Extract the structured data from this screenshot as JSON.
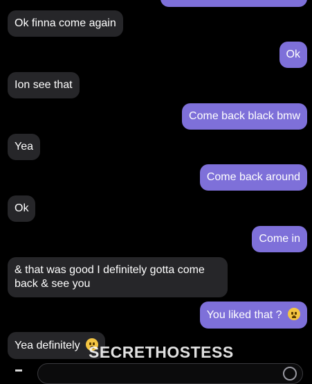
{
  "messages": [
    {
      "direction": "out",
      "text": ""
    },
    {
      "direction": "in",
      "text": "Ok finna come again"
    },
    {
      "direction": "out",
      "text": "Ok"
    },
    {
      "direction": "in",
      "text": "Ion see that"
    },
    {
      "direction": "out",
      "text": "Come back black bmw"
    },
    {
      "direction": "in",
      "text": "Yea"
    },
    {
      "direction": "out",
      "text": "Come back around"
    },
    {
      "direction": "in",
      "text": "Ok"
    },
    {
      "direction": "out",
      "text": "Come in"
    },
    {
      "direction": "in",
      "text": "& that was good I definitely gotta come back & see you"
    },
    {
      "direction": "out",
      "text": "You liked that ?"
    },
    {
      "direction": "in",
      "text": "Yea definitely"
    }
  ],
  "watermark": "SECRETHOSTESS",
  "colors": {
    "background": "#000000",
    "incoming_bubble": "#262629",
    "outgoing_bubble": "#7e70d9",
    "text": "#ffffff"
  },
  "icons": {
    "tired_face": "tired-face-emoji",
    "pleading_face": "pleading-face-emoji",
    "composer_emoji": "smiley-icon"
  }
}
